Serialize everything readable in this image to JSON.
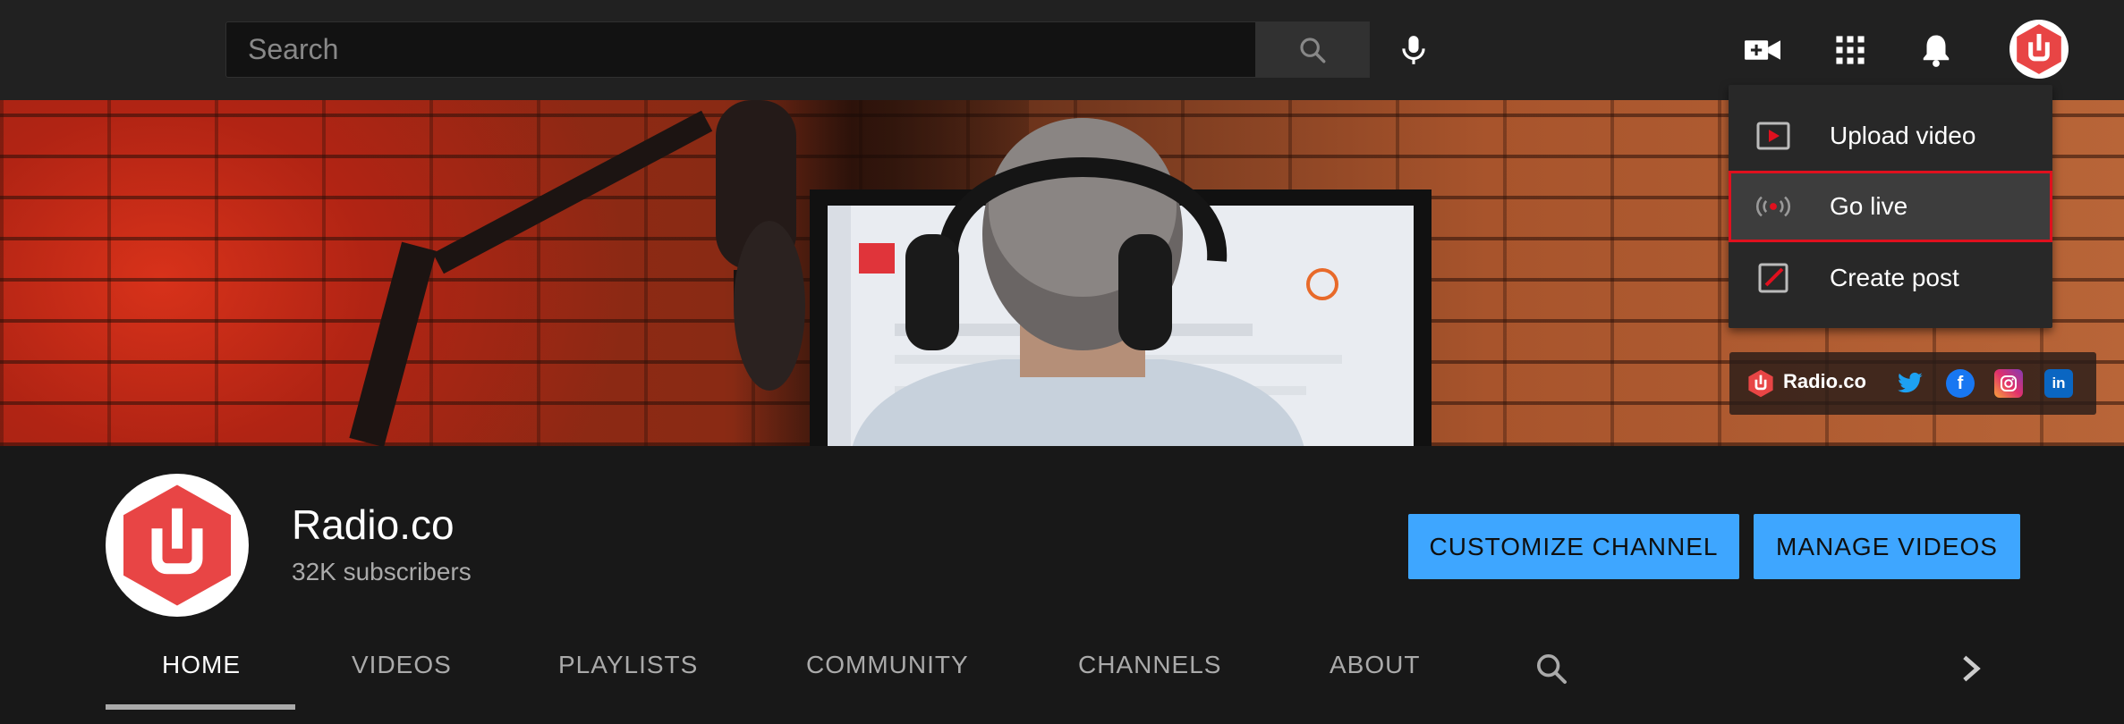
{
  "header": {
    "search_placeholder": "Search",
    "icons": [
      "search-icon",
      "mic-icon",
      "create-video-icon",
      "apps-grid-icon",
      "bell-icon",
      "radio-co-avatar"
    ]
  },
  "create_menu": {
    "items": [
      {
        "label": "Upload video",
        "icon": "upload-video-icon"
      },
      {
        "label": "Go live",
        "icon": "go-live-icon",
        "highlighted": true
      },
      {
        "label": "Create post",
        "icon": "create-post-icon"
      }
    ]
  },
  "banner": {
    "brand": "Radio.co",
    "social_icons": [
      "twitter-icon",
      "facebook-icon",
      "instagram-icon",
      "linkedin-icon"
    ]
  },
  "channel": {
    "name": "Radio.co",
    "subscribers": "32K subscribers",
    "customize_label": "CUSTOMIZE CHANNEL",
    "manage_label": "MANAGE VIDEOS"
  },
  "tabs": [
    {
      "label": "HOME",
      "active": true
    },
    {
      "label": "VIDEOS"
    },
    {
      "label": "PLAYLISTS"
    },
    {
      "label": "COMMUNITY"
    },
    {
      "label": "CHANNELS"
    },
    {
      "label": "ABOUT"
    }
  ],
  "colors": {
    "background": "#181818",
    "topbar": "#212121",
    "accent_blue": "#3ea6ff",
    "brand_red": "#e84545",
    "highlight_red": "#e0101e"
  }
}
